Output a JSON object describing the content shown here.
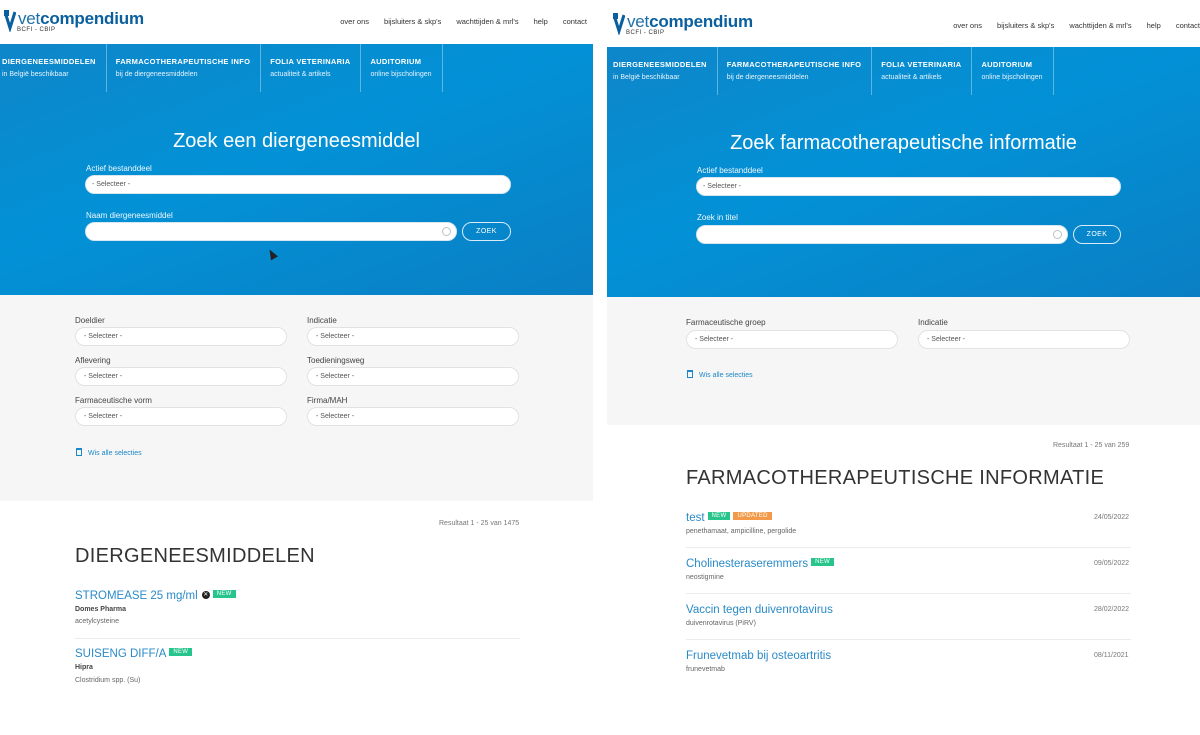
{
  "left": {
    "logo": {
      "brand_a": "vet",
      "brand_b": "compendium",
      "sub": "BCFI - CBIP"
    },
    "topnav": [
      "over ons",
      "bijsluiters & skp's",
      "wachttijden & mrl's",
      "help",
      "contact"
    ],
    "mainnav": [
      {
        "title": "DIERGENEESMIDDELEN",
        "sub": "in België beschikbaar"
      },
      {
        "title": "FARMACOTHERAPEUTISCHE INFO",
        "sub": "bij de diergeneesmiddelen"
      },
      {
        "title": "FOLIA VETERINARIA",
        "sub": "actualiteit & artikels"
      },
      {
        "title": "AUDITORIUM",
        "sub": "online bijscholingen"
      }
    ],
    "hero_title": "Zoek een diergeneesmiddel",
    "field1": {
      "label": "Actief bestanddeel",
      "placeholder": "- Selecteer -"
    },
    "field2": {
      "label": "Naam diergeneesmiddel",
      "placeholder": ""
    },
    "search_button": "ZOEK",
    "filters": [
      {
        "label": "Doeldier",
        "value": "- Selecteer -"
      },
      {
        "label": "Indicatie",
        "value": "- Selecteer -"
      },
      {
        "label": "Aflevering",
        "value": "- Selecteer -"
      },
      {
        "label": "Toedieningsweg",
        "value": "- Selecteer -"
      },
      {
        "label": "Farmaceutische vorm",
        "value": "- Selecteer -"
      },
      {
        "label": "Firma/MAH",
        "value": "- Selecteer -"
      }
    ],
    "clear": "Wis alle selecties",
    "result_count": "Resultaat 1 - 25 van 1475",
    "section_title": "DIERGENEESMIDDELEN",
    "items": [
      {
        "title": "STROMEASE 25 mg/ml",
        "badge": "NEW",
        "company": "Domes Pharma",
        "substance": "acetylcysteine"
      },
      {
        "title": "SUISENG DIFF/A",
        "badge": "NEW",
        "company": "Hipra",
        "substance": "Clostridium spp. (Su)"
      }
    ]
  },
  "right": {
    "logo": {
      "brand_a": "vet",
      "brand_b": "compendium",
      "sub": "BCFI - CBIP"
    },
    "topnav": [
      "over ons",
      "bijsluiters & skp's",
      "wachttijden & mrl's",
      "help",
      "contact"
    ],
    "mainnav": [
      {
        "title": "DIERGENEESMIDDELEN",
        "sub": "in België beschikbaar"
      },
      {
        "title": "FARMACOTHERAPEUTISCHE INFO",
        "sub": "bij de diergeneesmiddelen"
      },
      {
        "title": "FOLIA VETERINARIA",
        "sub": "actualiteit & artikels"
      },
      {
        "title": "AUDITORIUM",
        "sub": "online bijscholingen"
      }
    ],
    "hero_title": "Zoek farmacotherapeutische informatie",
    "field1": {
      "label": "Actief bestanddeel",
      "placeholder": "- Selecteer -"
    },
    "field2": {
      "label": "Zoek in titel",
      "placeholder": ""
    },
    "search_button": "ZOEK",
    "filters": [
      {
        "label": "Farmaceutische groep",
        "value": "- Selecteer -"
      },
      {
        "label": "Indicatie",
        "value": "- Selecteer -"
      }
    ],
    "clear": "Wis alle selecties",
    "result_count": "Resultaat 1 - 25 van 259",
    "section_title": "FARMACOTHERAPEUTISCHE INFORMATIE",
    "items": [
      {
        "title": "test",
        "badges": [
          "NEW",
          "UPDATED"
        ],
        "sub": "penethamaat, ampicilline, pergolide",
        "date": "24/05/2022"
      },
      {
        "title": "Cholinesteraseremmers",
        "badges": [
          "NEW"
        ],
        "sub": "neostigmine",
        "date": "09/05/2022"
      },
      {
        "title": "Vaccin tegen duivenrotavirus",
        "badges": [],
        "sub": "duivenrotavirus (PiRV)",
        "date": "28/02/2022"
      },
      {
        "title": "Frunevetmab bij osteoartritis",
        "badges": [],
        "sub": "frunevetmab",
        "date": "08/11/2021"
      }
    ]
  },
  "colors": {
    "primary_blue": "#0391d6",
    "link_blue": "#2a8ac8",
    "badge_new": "#27c48b",
    "badge_updated": "#f29a4a"
  },
  "icons": [
    "vetcompendium-logo-icon",
    "trash-icon",
    "clear-x-icon",
    "spinner-icon",
    "mouse-cursor-icon"
  ]
}
